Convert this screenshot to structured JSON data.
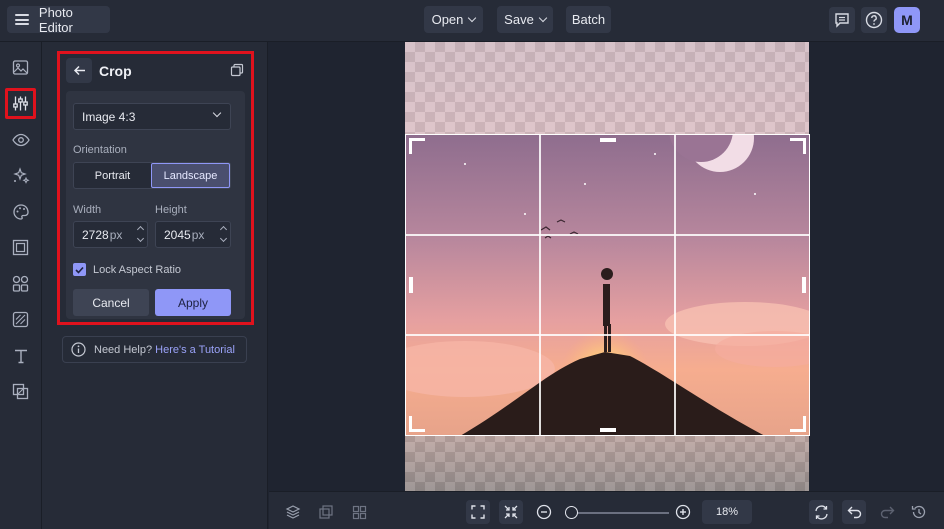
{
  "app": {
    "title": "Photo Editor",
    "menu_icon": "hamburger-menu-icon",
    "avatar_letter": "M"
  },
  "toolbar": {
    "open_label": "Open",
    "save_label": "Save",
    "batch_label": "Batch",
    "icons": [
      "comment-icon",
      "help-icon"
    ]
  },
  "sidebar": {
    "items": [
      {
        "name": "image-icon",
        "active": false
      },
      {
        "name": "adjust-sliders-icon",
        "active": true
      },
      {
        "name": "eye-icon",
        "active": false
      },
      {
        "name": "sparkle-effects-icon",
        "active": false
      },
      {
        "name": "paint-palette-icon",
        "active": false
      },
      {
        "name": "frame-icon",
        "active": false
      },
      {
        "name": "graphics-shapes-icon",
        "active": false
      },
      {
        "name": "texture-icon",
        "active": false
      },
      {
        "name": "text-icon",
        "active": false
      },
      {
        "name": "overlay-icon",
        "active": false
      }
    ]
  },
  "crop": {
    "title": "Crop",
    "ratio_select": "Image 4:3",
    "orientation_label": "Orientation",
    "portrait": "Portrait",
    "landscape": "Landscape",
    "selected_orientation": "Landscape",
    "width_label": "Width",
    "height_label": "Height",
    "width_value": "2728",
    "height_value": "2045",
    "unit": "px",
    "lock_label": "Lock Aspect Ratio",
    "lock_checked": true,
    "cancel": "Cancel",
    "apply": "Apply"
  },
  "help": {
    "prefix": "Need Help?",
    "link": "Here's a Tutorial"
  },
  "bottom": {
    "zoom_value": "18%",
    "zoom_level": 0.02,
    "icons": [
      "layers-icon",
      "duplicate-icon",
      "grid-icon",
      "fit-screen-icon",
      "shrink-icon",
      "zoom-out-icon",
      "zoom-in-icon",
      "flip-rotate-icon",
      "undo-icon",
      "redo-icon",
      "history-icon"
    ]
  },
  "colors": {
    "accent": "#8f97f7",
    "highlight": "#e0121d",
    "panel": "#262b37",
    "card": "#2f3441"
  }
}
